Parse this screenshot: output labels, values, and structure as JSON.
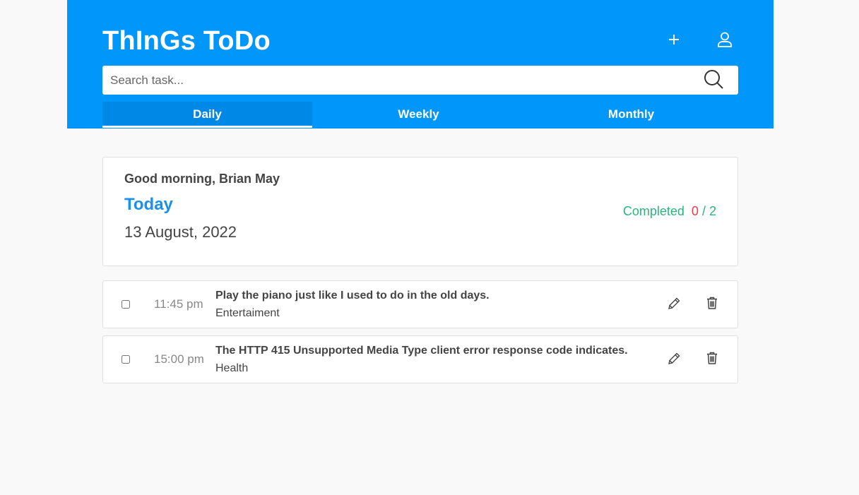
{
  "app": {
    "title": "ThInGs ToDo"
  },
  "header": {
    "add_icon": "plus-icon",
    "user_icon": "user-icon",
    "background": "#0096fa"
  },
  "search": {
    "placeholder": "Search task...",
    "value": "",
    "icon": "search-icon"
  },
  "tabs": [
    {
      "label": "Daily",
      "active": true
    },
    {
      "label": "Weekly",
      "active": false
    },
    {
      "label": "Monthly",
      "active": false
    }
  ],
  "summary": {
    "greeting": "Good morning, Brian May",
    "period": "Today",
    "date": "13 August, 2022",
    "completed_label": "Completed",
    "completed_count": "0",
    "separator": "/",
    "total_count": "2",
    "accent_color": "#1890f0",
    "completed_color": "#2ab57a",
    "count_color": "#e04050"
  },
  "tasks": [
    {
      "time": "11:45 pm",
      "title": "Play the piano just like I used to do in the old days.",
      "category": "Entertaiment",
      "checked": false,
      "edit_icon": "pencil-icon",
      "delete_icon": "trash-icon"
    },
    {
      "time": "15:00 pm",
      "title": "The HTTP 415 Unsupported Media Type client error response code indicates.",
      "category": "Health",
      "checked": false,
      "edit_icon": "pencil-icon",
      "delete_icon": "trash-icon"
    }
  ]
}
